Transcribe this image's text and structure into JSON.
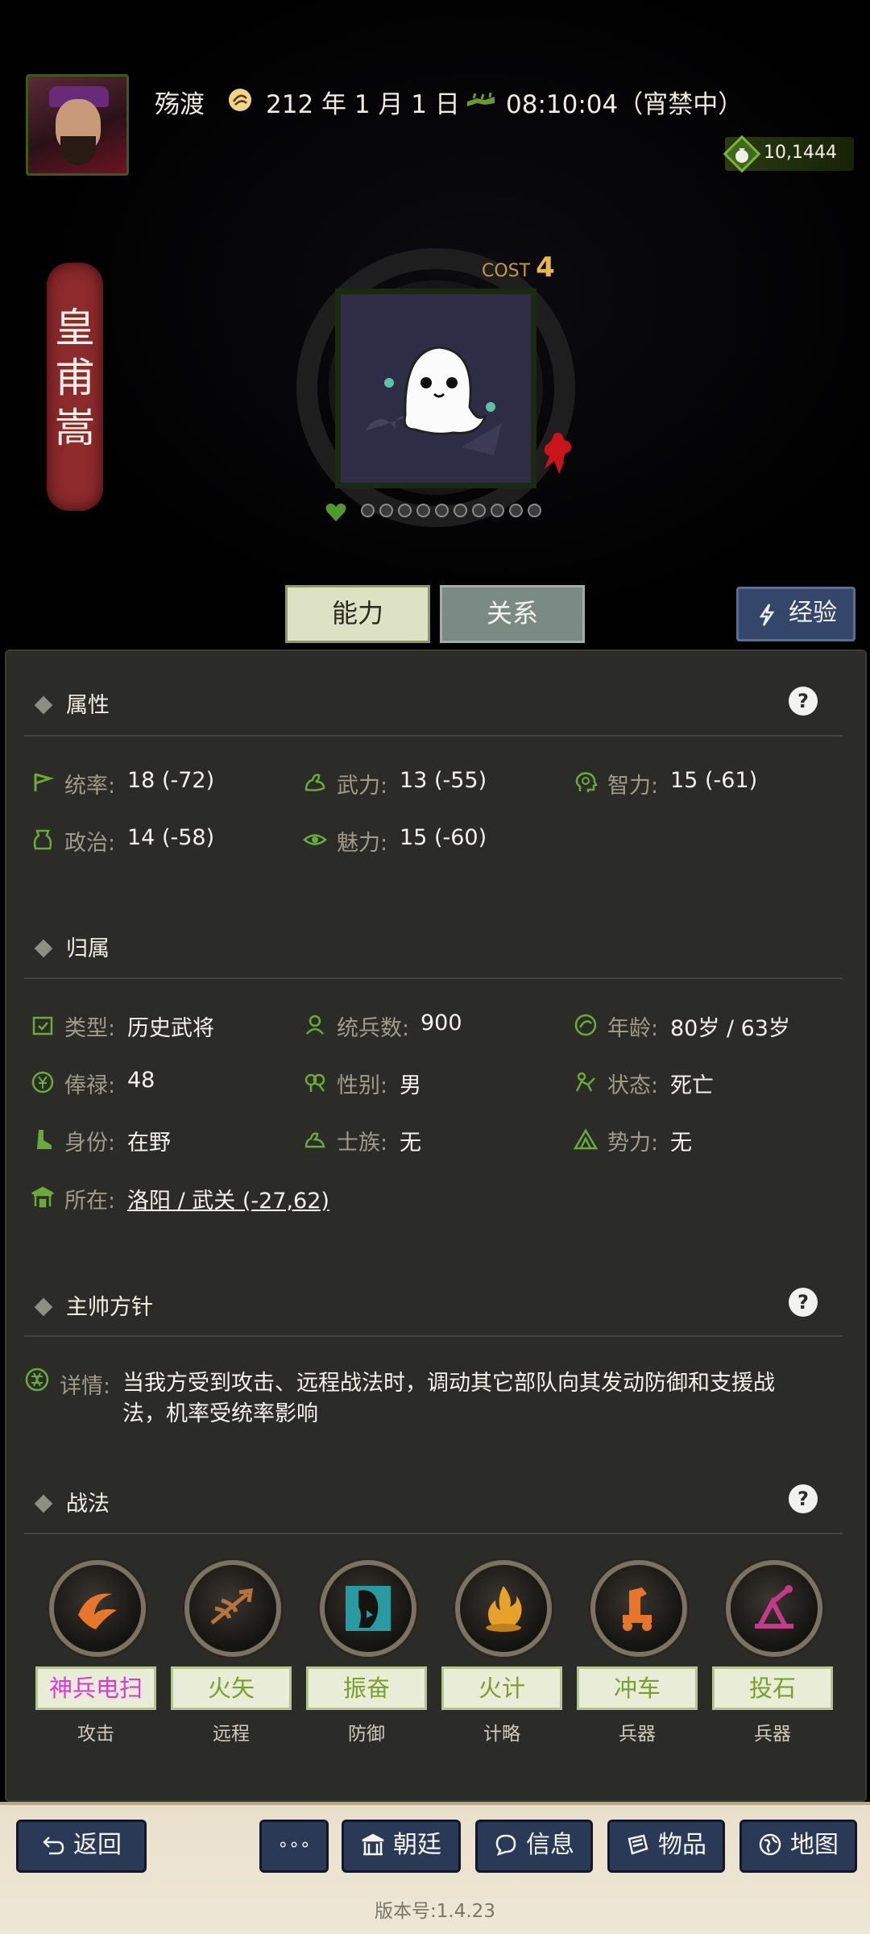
{
  "header": {
    "player_name": "殇渡",
    "date": "212 年 1 月 1 日",
    "time": "08:10:04（宵禁中）",
    "money": "10,1444"
  },
  "general": {
    "name_chars": [
      "皇",
      "甫",
      "嵩"
    ],
    "cost_label": "COST",
    "cost_value": "4"
  },
  "tabs": {
    "ability": "能力",
    "relation": "关系",
    "exp": "经验"
  },
  "attributes": {
    "title": "属性",
    "items": [
      {
        "label": "统率:",
        "value": "18 (-72)",
        "icon": "flag-icon"
      },
      {
        "label": "武力:",
        "value": "13 (-55)",
        "icon": "arm-icon"
      },
      {
        "label": "智力:",
        "value": "15 (-61)",
        "icon": "brain-icon"
      },
      {
        "label": "政治:",
        "value": "14 (-58)",
        "icon": "bag-icon"
      },
      {
        "label": "魅力:",
        "value": "15 (-60)",
        "icon": "eye-icon"
      }
    ]
  },
  "affiliation": {
    "title": "归属",
    "items": [
      {
        "label": "类型:",
        "value": "历史武将"
      },
      {
        "label": "统兵数:",
        "value": "900"
      },
      {
        "label": "年龄:",
        "value": "80岁 / 63岁"
      },
      {
        "label": "俸禄:",
        "value": "48"
      },
      {
        "label": "性别:",
        "value": "男"
      },
      {
        "label": "状态:",
        "value": "死亡"
      },
      {
        "label": "身份:",
        "value": "在野"
      },
      {
        "label": "士族:",
        "value": "无"
      },
      {
        "label": "势力:",
        "value": "无"
      }
    ],
    "location_label": "所在:",
    "location_value": "洛阳 / 武关 (-27,62)"
  },
  "policy": {
    "title": "主帅方针",
    "detail_label": "详情:",
    "detail_text": "当我方受到攻击、远程战法时，调动其它部队向其发动防御和支援战法，机率受统率影响"
  },
  "tactics": {
    "title": "战法",
    "items": [
      {
        "name": "神兵电扫",
        "type": "攻击",
        "name_color": "#d93ad6",
        "icon": "lightning-sweep-icon"
      },
      {
        "name": "火矢",
        "type": "远程",
        "name_color": "#7aa02c",
        "icon": "fire-arrow-icon"
      },
      {
        "name": "振奋",
        "type": "防御",
        "name_color": "#7aa02c",
        "icon": "roar-icon"
      },
      {
        "name": "火计",
        "type": "计略",
        "name_color": "#7aa02c",
        "icon": "flame-icon"
      },
      {
        "name": "冲车",
        "type": "兵器",
        "name_color": "#7aa02c",
        "icon": "ram-icon"
      },
      {
        "name": "投石",
        "type": "兵器",
        "name_color": "#7aa02c",
        "icon": "catapult-icon"
      }
    ]
  },
  "bottom_bar": {
    "back": "返回",
    "more": "∘∘∘",
    "court": "朝廷",
    "info": "信息",
    "items": "物品",
    "map": "地图",
    "version": "版本号:1.4.23"
  },
  "colors": {
    "panel_bg": "#2b2c28",
    "label": "#9f9a8a",
    "value": "#f4f2ea",
    "link": "#6fae2c",
    "accent_green": "#3b5a1c"
  }
}
